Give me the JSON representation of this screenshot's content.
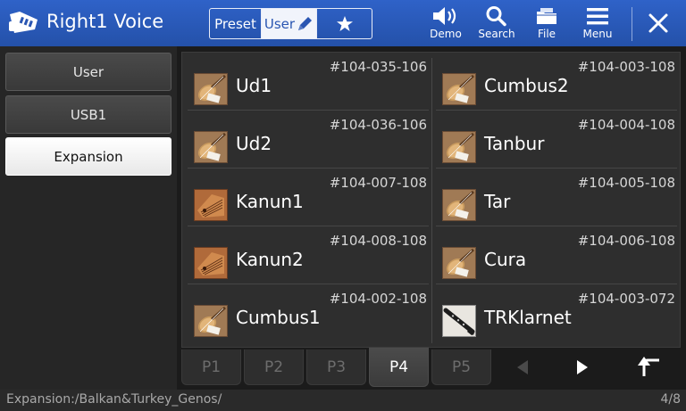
{
  "header": {
    "title": "Right1 Voice",
    "app_icon": "keyboard-icon",
    "tabs": [
      {
        "label": "Preset",
        "selected": false
      },
      {
        "label": "User",
        "selected": true,
        "icon": "pencil-icon"
      },
      {
        "label": "",
        "icon": "star-icon",
        "selected": false
      }
    ],
    "buttons": {
      "demo": "Demo",
      "search": "Search",
      "file": "File",
      "menu": "Menu"
    },
    "close_icon": "close-icon"
  },
  "sidebar": {
    "items": [
      {
        "label": "User",
        "selected": false
      },
      {
        "label": "USB1",
        "selected": false
      },
      {
        "label": "Expansion",
        "selected": true
      }
    ]
  },
  "voices": [
    {
      "name": "Ud1",
      "number": "#104-035-106",
      "icon": "lute-icon"
    },
    {
      "name": "Cumbus2",
      "number": "#104-003-108",
      "icon": "lute-icon"
    },
    {
      "name": "Ud2",
      "number": "#104-036-106",
      "icon": "lute-icon"
    },
    {
      "name": "Tanbur",
      "number": "#104-004-108",
      "icon": "lute-icon"
    },
    {
      "name": "Kanun1",
      "number": "#104-007-108",
      "icon": "zither-icon"
    },
    {
      "name": "Tar",
      "number": "#104-005-108",
      "icon": "lute-icon"
    },
    {
      "name": "Kanun2",
      "number": "#104-008-108",
      "icon": "zither-icon"
    },
    {
      "name": "Cura",
      "number": "#104-006-108",
      "icon": "lute-icon"
    },
    {
      "name": "Cumbus1",
      "number": "#104-002-108",
      "icon": "lute-icon"
    },
    {
      "name": "TRKlarnet",
      "number": "#104-003-072",
      "icon": "clarinet-icon"
    }
  ],
  "pager": {
    "pages": [
      "P1",
      "P2",
      "P3",
      "P4",
      "P5"
    ],
    "active_page": "P4"
  },
  "status": {
    "path": "Expansion:/Balkan&Turkey_Genos/",
    "page_count": "4/8"
  },
  "colors": {
    "header_blue": "#2a5ab8",
    "selected_bg": "#f1f4fb"
  }
}
